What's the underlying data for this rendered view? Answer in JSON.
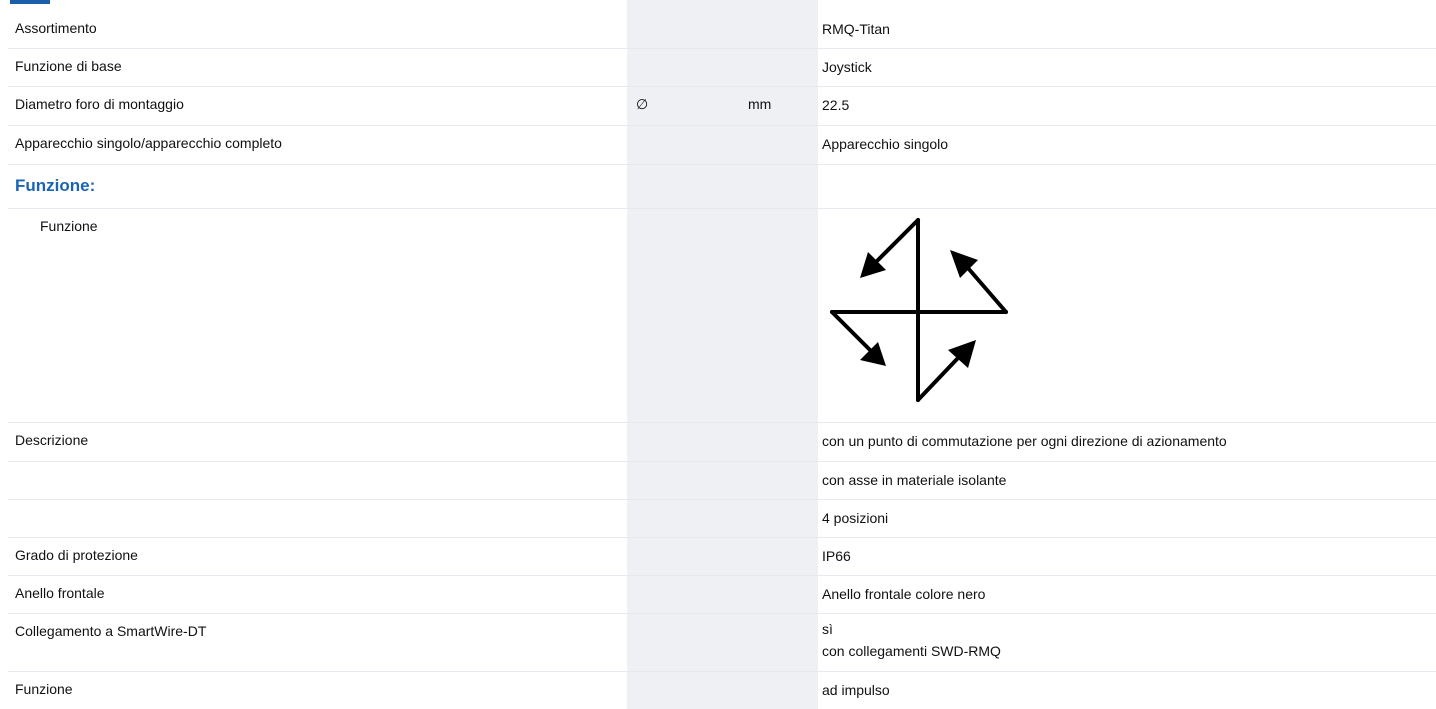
{
  "rows": [
    {
      "label": "Assortimento",
      "symbol": "",
      "unit": "",
      "value": "RMQ-Titan"
    },
    {
      "label": "Funzione di base",
      "symbol": "",
      "unit": "",
      "value": "Joystick"
    },
    {
      "label": "Diametro foro di montaggio",
      "symbol": "∅",
      "unit": "mm",
      "value": "22.5"
    },
    {
      "label": "Apparecchio singolo/apparecchio completo",
      "symbol": "",
      "unit": "",
      "value": "Apparecchio singolo"
    }
  ],
  "section": {
    "heading": "Funzione:",
    "function_label": "Funzione",
    "function_image_icon": "joystick-4-direction-arrows-icon"
  },
  "rows2": [
    {
      "label": "Descrizione",
      "value": "con un punto di commutazione per ogni direzione di azionamento"
    },
    {
      "label": "",
      "value": "con asse in materiale isolante"
    },
    {
      "label": "",
      "value": "4 posizioni"
    },
    {
      "label": "Grado di protezione",
      "value": "IP66"
    },
    {
      "label": "Anello frontale",
      "value": "Anello frontale colore nero"
    },
    {
      "label": "Collegamento a SmartWire-DT",
      "value": "sì",
      "value2": "con collegamenti SWD-RMQ"
    },
    {
      "label": "Funzione",
      "value": "ad impulso"
    }
  ],
  "colors": {
    "heading": "#1a64b4",
    "unit_column_shade": "#eef0f4",
    "row_border": "#e7e9ee"
  }
}
